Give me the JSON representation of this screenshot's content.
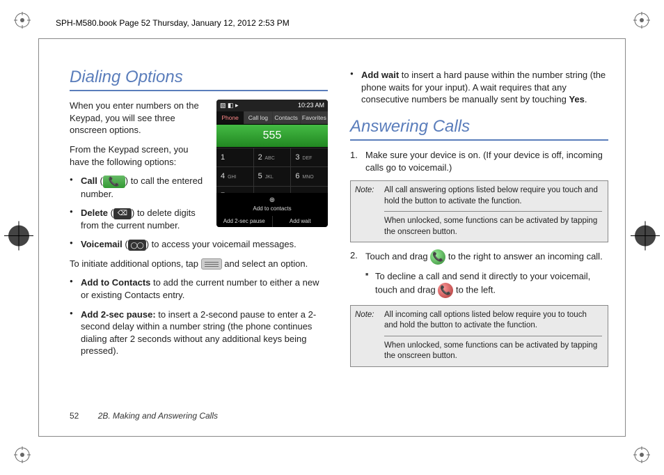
{
  "header": "SPH-M580.book  Page 52  Thursday, January 12, 2012  2:53 PM",
  "footer": {
    "page": "52",
    "section": "2B. Making and Answering Calls"
  },
  "left": {
    "heading": "Dialing Options",
    "p1": "When you enter numbers on the Keypad, you will see three onscreen options.",
    "p2": "From the Keypad screen, you have the following options:",
    "call": {
      "label": "Call",
      "after": " to call the entered number."
    },
    "delete": {
      "label": "Delete",
      "after": " to delete digits from the current number."
    },
    "vm": {
      "label": "Voicemail",
      "after": " to access your voicemail messages."
    },
    "p3a": "To initiate additional options, tap ",
    "p3b": " and select an option.",
    "addc": {
      "label": "Add to Contacts",
      "after": " to add the current number to either a new or existing Contacts entry."
    },
    "pause": {
      "label": "Add 2-sec pause:",
      "after": " to insert a 2-second pause to enter a 2-second delay within a number string (the phone continues dialing after 2 seconds without any additional keys being pressed)."
    }
  },
  "right": {
    "addwait": {
      "label": "Add wait",
      "after": " to insert a hard pause within the number string (the phone waits for your input). A wait requires that any consecutive numbers be manually sent by touching ",
      "yes": "Yes",
      "period": "."
    },
    "heading": "Answering Calls",
    "step1": "Make sure your device is on. (If your device is off, incoming calls go to voicemail.)",
    "note1a": "All call answering options listed below require you touch and hold the button to activate the function.",
    "note1b": "When unlocked, some functions can be activated by tapping the onscreen button.",
    "step2a": "Touch and drag ",
    "step2b": " to the right to answer an incoming call.",
    "decline_a": "To decline a call and send it directly to your voicemail, touch and drag ",
    "decline_b": " to the left.",
    "note2a": "All incoming call options listed below require you to touch and hold the button to activate the function.",
    "note2b": "When unlocked, some functions can be activated by tapping the onscreen button.",
    "noteLabel": "Note:"
  },
  "phone": {
    "time": "10:23 AM",
    "tabs": [
      "Phone",
      "Call log",
      "Contacts",
      "Favorites"
    ],
    "number": "555",
    "keys": [
      [
        "1",
        "2 ABC",
        "3 DEF"
      ],
      [
        "4 GHI",
        "5 JKL",
        "6 MNO"
      ]
    ],
    "addContacts": "Add to contacts",
    "bottom": [
      "Add 2-sec pause",
      "Add wait"
    ]
  }
}
